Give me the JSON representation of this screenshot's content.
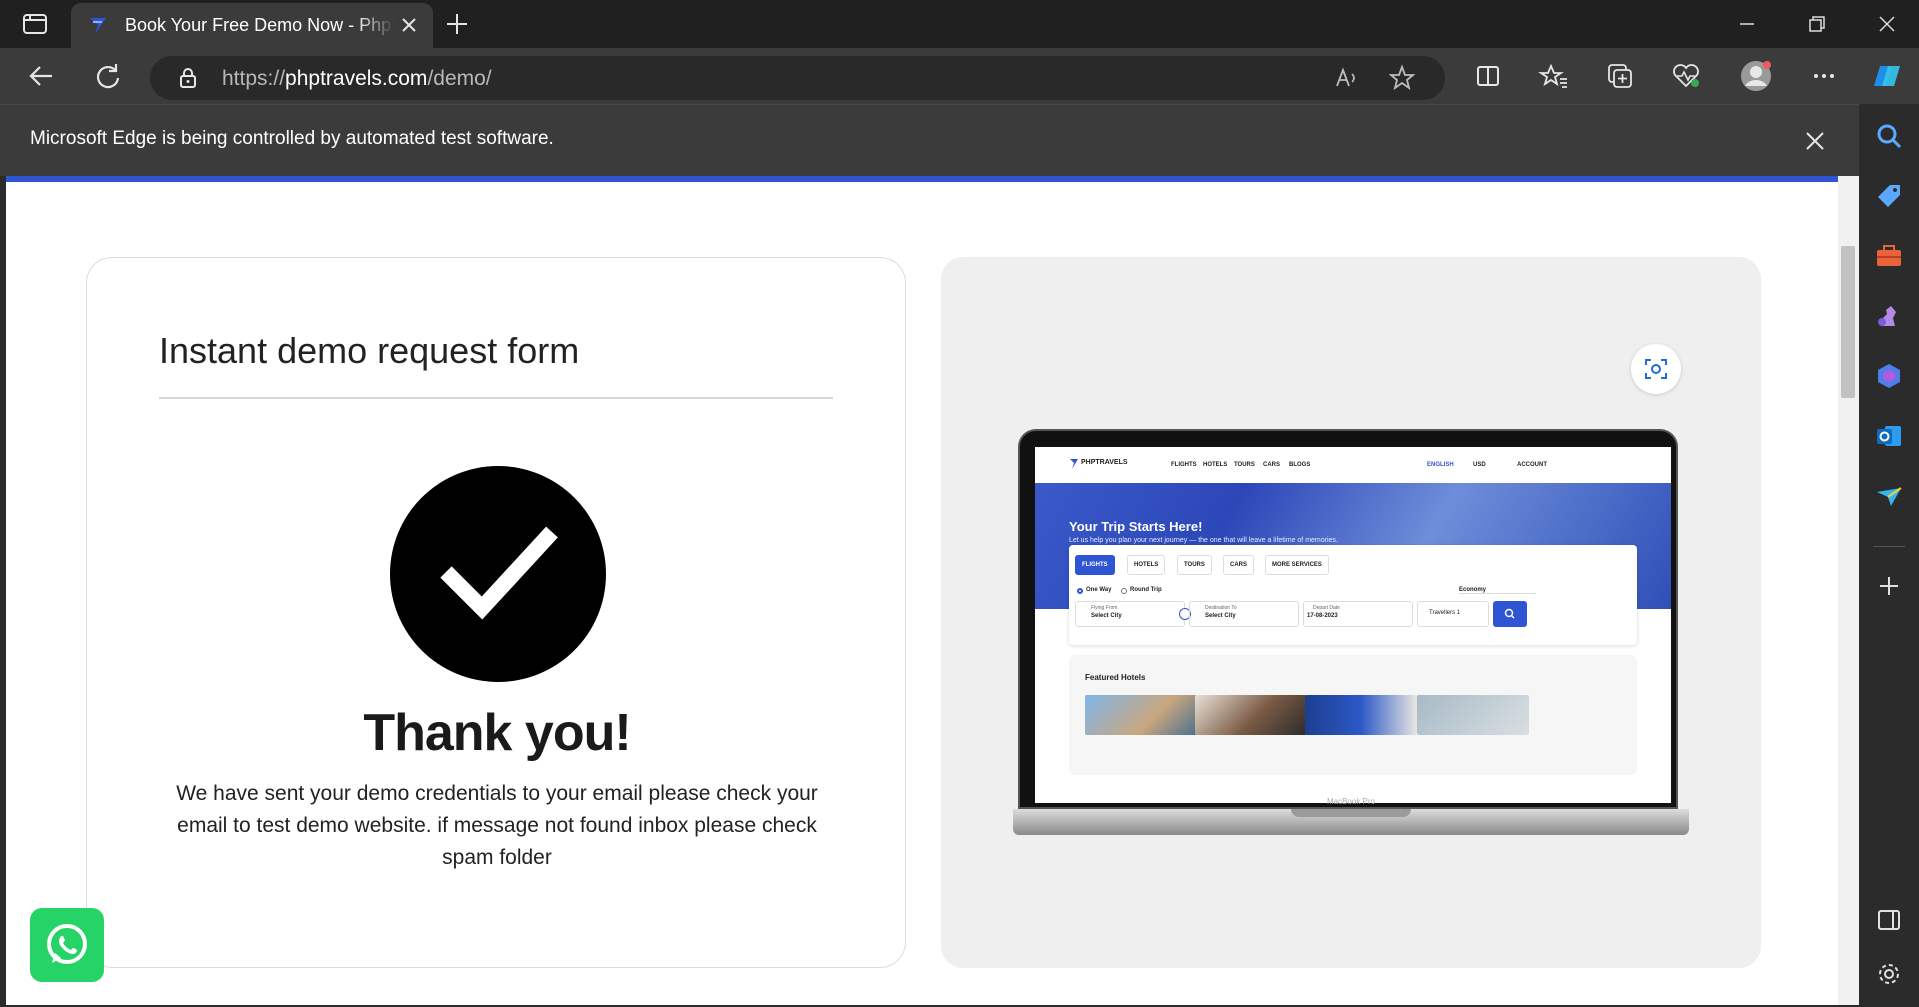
{
  "browser": {
    "tab": {
      "title": "Book Your Free Demo Now - PhpTravels"
    },
    "address": {
      "scheme": "https://",
      "host": "phptravels.com",
      "path": "/demo/"
    },
    "infobar": {
      "message": "Microsoft Edge is being controlled by automated test software."
    },
    "colors": {
      "chrome_dark": "#202020",
      "chrome": "#3b3b3b",
      "accent": "#2f54d4"
    }
  },
  "form_card": {
    "title": "Instant demo request form",
    "thanks_heading": "Thank you!",
    "thanks_message": "We have sent your demo credentials to your email please check your email to test demo website. if message not found inbox please check spam folder"
  },
  "preview": {
    "laptop_label": "MacBook Pro",
    "site": {
      "brand": "PHPTRAVELS",
      "nav": [
        "FLIGHTS",
        "HOTELS",
        "TOURS",
        "CARS",
        "BLOGS"
      ],
      "language": "ENGLISH",
      "currency": "USD",
      "account": "ACCOUNT",
      "hero_title": "Your Trip Starts Here!",
      "hero_subtitle": "Let us help you plan your next journey — the one that will leave a lifetime of memories.",
      "tabs": [
        "FLIGHTS",
        "HOTELS",
        "TOURS",
        "CARS",
        "MORE SERVICES"
      ],
      "trip_one_way": "One Way",
      "trip_round": "Round Trip",
      "cabin": "Economy",
      "flying_from_label": "Flying From",
      "flying_from_value": "Select City",
      "destination_label": "Destination To",
      "destination_value": "Select City",
      "depart_label": "Depart Date",
      "depart_value": "17-08-2023",
      "travellers": "Travellers 1",
      "featured_title": "Featured Hotels"
    }
  }
}
